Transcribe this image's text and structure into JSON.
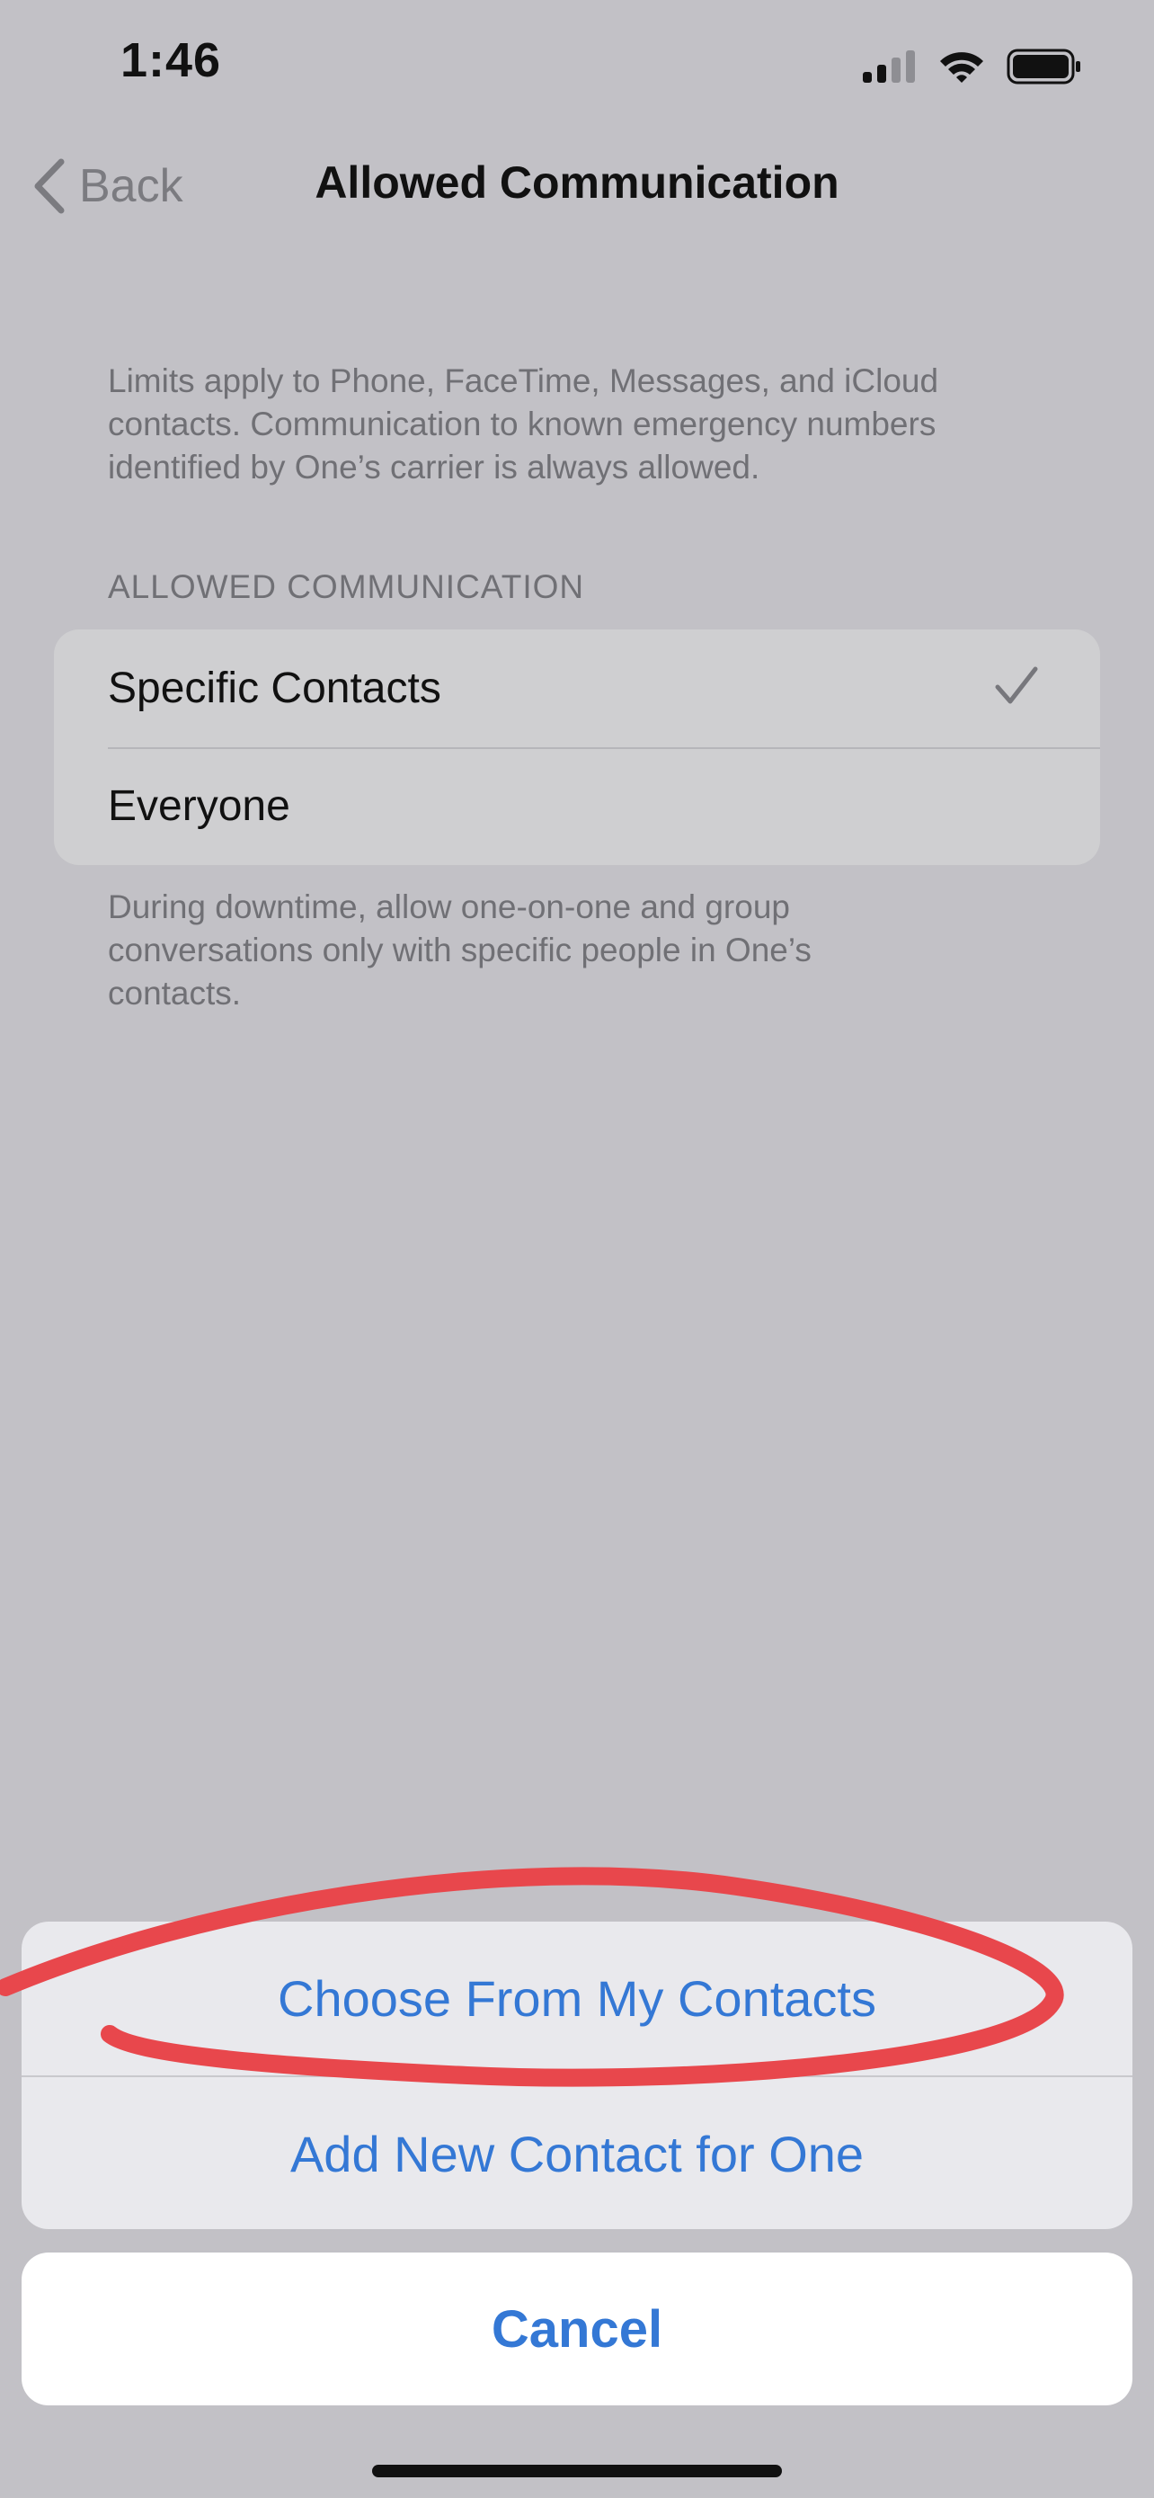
{
  "status_bar": {
    "time": "1:46",
    "icons": [
      "cellular-signal-icon",
      "wifi-icon",
      "battery-icon"
    ]
  },
  "nav": {
    "back_label": "Back",
    "title": "Allowed Communication"
  },
  "top_note": [
    "Limits apply to Phone, FaceTime, Messages, and iCloud",
    "contacts. Communication to known emergency numbers",
    "identified by One’s carrier is always allowed."
  ],
  "section": {
    "header": "ALLOWED COMMUNICATION",
    "options": [
      {
        "label": "Specific Contacts",
        "selected": true
      },
      {
        "label": "Everyone",
        "selected": false
      }
    ]
  },
  "footer_note": [
    "During downtime, allow one-on-one and group",
    "conversations only with specific people in One’s",
    "contacts."
  ],
  "action_sheet": {
    "actions": [
      "Choose From My Contacts",
      "Add New Contact for One"
    ],
    "cancel_label": "Cancel"
  },
  "colors": {
    "background": "#c2c1c6",
    "accent": "#3478d5",
    "annotation": "#e8474c"
  }
}
